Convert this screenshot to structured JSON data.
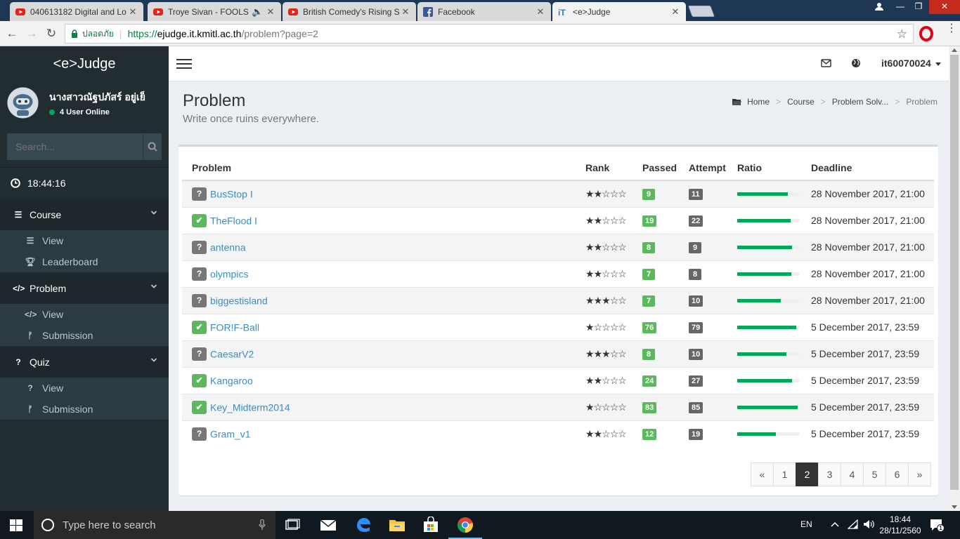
{
  "browser": {
    "tabs": [
      {
        "title": "040613182 Digital and Lo",
        "icon": "youtube-icon"
      },
      {
        "title": "Troye Sivan - FOOLS (",
        "icon": "youtube-icon"
      },
      {
        "title": "British Comedy's Rising S",
        "icon": "youtube-icon"
      },
      {
        "title": "Facebook",
        "icon": "facebook-icon"
      },
      {
        "title": "<e>Judge",
        "icon": "kmitl-icon"
      }
    ],
    "secure_label": "ปลอดภัย",
    "url_scheme": "https://",
    "url_host": "ejudge.it.kmitl.ac.th",
    "url_path": "/problem?page=2"
  },
  "sidebar": {
    "logo": "<e>Judge",
    "user_name": "นางสาวณัฐปภัสร์ อยู่เย็",
    "online_status": "4 User Online",
    "search_placeholder": "Search...",
    "clock": "18:44:16",
    "sections": [
      {
        "label": "Course",
        "items": [
          "View",
          "Leaderboard"
        ]
      },
      {
        "label": "Problem",
        "items": [
          "View",
          "Submission"
        ]
      },
      {
        "label": "Quiz",
        "items": [
          "View",
          "Submission"
        ]
      }
    ]
  },
  "header": {
    "account": "it60070024"
  },
  "page": {
    "title": "Problem",
    "subtitle": "Write once ruins everywhere.",
    "breadcrumb": [
      "Home",
      "Course",
      "Problem Solv...",
      "Problem"
    ]
  },
  "table": {
    "columns": [
      "Problem",
      "Rank",
      "Passed",
      "Attempt",
      "Ratio",
      "Deadline"
    ],
    "rows": [
      {
        "status": "unsolved",
        "name": "BusStop I",
        "rank": 2,
        "passed": "9",
        "attempt": "11",
        "ratio": 0.82,
        "deadline": "28 November 2017, 21:00"
      },
      {
        "status": "solved",
        "name": "TheFlood I",
        "rank": 2,
        "passed": "19",
        "attempt": "22",
        "ratio": 0.86,
        "deadline": "28 November 2017, 21:00"
      },
      {
        "status": "unsolved",
        "name": "antenna",
        "rank": 2,
        "passed": "8",
        "attempt": "9",
        "ratio": 0.89,
        "deadline": "28 November 2017, 21:00"
      },
      {
        "status": "unsolved",
        "name": "olympics",
        "rank": 2,
        "passed": "7",
        "attempt": "8",
        "ratio": 0.88,
        "deadline": "28 November 2017, 21:00"
      },
      {
        "status": "unsolved",
        "name": "biggestisland",
        "rank": 3,
        "passed": "7",
        "attempt": "10",
        "ratio": 0.7,
        "deadline": "28 November 2017, 21:00"
      },
      {
        "status": "solved",
        "name": "FOR!F-Ball",
        "rank": 1,
        "passed": "76",
        "attempt": "79",
        "ratio": 0.96,
        "deadline": "5 December 2017, 23:59"
      },
      {
        "status": "unsolved",
        "name": "CaesarV2",
        "rank": 3,
        "passed": "8",
        "attempt": "10",
        "ratio": 0.8,
        "deadline": "5 December 2017, 23:59"
      },
      {
        "status": "solved",
        "name": "Kangaroo",
        "rank": 2,
        "passed": "24",
        "attempt": "27",
        "ratio": 0.89,
        "deadline": "5 December 2017, 23:59"
      },
      {
        "status": "solved",
        "name": "Key_Midterm2014",
        "rank": 1,
        "passed": "83",
        "attempt": "85",
        "ratio": 0.98,
        "deadline": "5 December 2017, 23:59"
      },
      {
        "status": "unsolved",
        "name": "Gram_v1",
        "rank": 2,
        "passed": "12",
        "attempt": "19",
        "ratio": 0.63,
        "deadline": "5 December 2017, 23:59"
      }
    ]
  },
  "pagination": {
    "prev": "«",
    "pages": [
      "1",
      "2",
      "3",
      "4",
      "5",
      "6"
    ],
    "current": "2",
    "next": "»"
  },
  "taskbar": {
    "search_placeholder": "Type here to search",
    "language": "EN",
    "time": "18:44",
    "date": "28/11/2560",
    "notifications": "1"
  },
  "colors": {
    "sidebar_bg": "#222d32",
    "accent_link": "#3c8dbc",
    "success": "#5cb85c",
    "ratio_fill": "#00a65a"
  }
}
